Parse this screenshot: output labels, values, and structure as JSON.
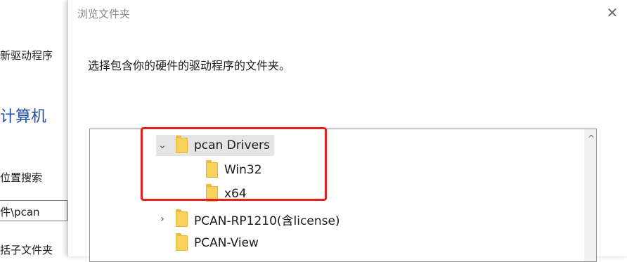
{
  "background_window": {
    "line1": "新驱动程序",
    "heading": "计算机",
    "line3": "位置搜索",
    "path_value": "件\\pcan",
    "line5": "括子文件夹"
  },
  "dialog": {
    "title": "浏览文件夹",
    "close_glyph": "✕",
    "instruction": "选择包含你的硬件的驱动程序的文件夹。"
  },
  "tree": {
    "items": [
      {
        "label": "pcan Drivers",
        "toggle": "⌄",
        "selected": true
      },
      {
        "label": "Win32",
        "toggle": ""
      },
      {
        "label": "x64",
        "toggle": ""
      },
      {
        "label": "PCAN-RP1210(含license)",
        "toggle": "›"
      },
      {
        "label": "PCAN-View",
        "toggle": ""
      }
    ],
    "scroll_up_glyph": "^"
  },
  "icons": {
    "folder": "folder-icon",
    "close": "close-icon"
  },
  "colors": {
    "annotation_red": "#e4211d",
    "folder_yellow": "#f7d15c",
    "heading_blue": "#1f4ea1"
  }
}
